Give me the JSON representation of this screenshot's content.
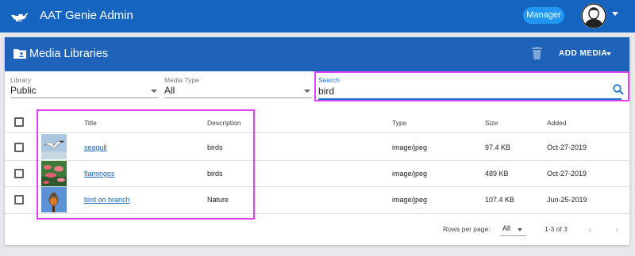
{
  "appbar": {
    "title": "AAT Genie Admin",
    "role_badge": "Manager",
    "bg_color": "#1565c0"
  },
  "card": {
    "title": "Media Libraries",
    "add_media_label": "ADD MEDIA",
    "header_color": "#1e63b9"
  },
  "filters": {
    "library": {
      "label": "Library",
      "value": "Public"
    },
    "media_type": {
      "label": "Media Type",
      "value": "All"
    },
    "search": {
      "label": "Search",
      "value": "bird"
    }
  },
  "table": {
    "columns": [
      "Title",
      "Description",
      "Type",
      "Size",
      "Added"
    ],
    "rows": [
      {
        "title": "seagull",
        "description": "birds",
        "type": "image/jpeg",
        "size": "97.4 KB",
        "added": "Oct-27-2019",
        "thumb": "seagull-thumbnail"
      },
      {
        "title": "flamingos",
        "description": "birds",
        "type": "image/jpeg",
        "size": "489 KB",
        "added": "Oct-27-2019",
        "thumb": "flamingos-thumbnail"
      },
      {
        "title": "bird on branch",
        "description": "Nature",
        "type": "image/jpeg",
        "size": "107.4 KB",
        "added": "Jun-25-2019",
        "thumb": "bird-on-branch-thumbnail"
      }
    ]
  },
  "pagination": {
    "rows_per_page_label": "Rows per page:",
    "rows_per_page_value": "All",
    "range": "1-3 of 3",
    "prev_icon": "chevron-left-icon",
    "next_icon": "chevron-right-icon"
  },
  "colors": {
    "accent": "#1976d2",
    "highlight": "#e040fb",
    "link": "#1565c0"
  }
}
